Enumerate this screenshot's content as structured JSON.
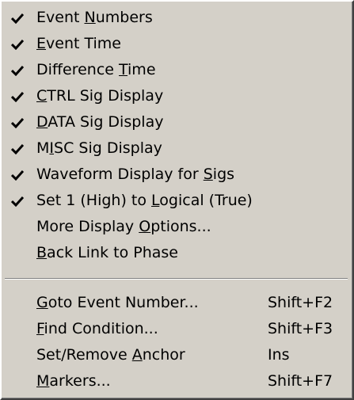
{
  "menu": {
    "items": [
      {
        "checked": true,
        "pre": "Event ",
        "ul": "N",
        "post": "umbers",
        "shortcut": ""
      },
      {
        "checked": true,
        "pre": "",
        "ul": "E",
        "post": "vent Time",
        "shortcut": ""
      },
      {
        "checked": true,
        "pre": "Difference ",
        "ul": "T",
        "post": "ime",
        "shortcut": ""
      },
      {
        "checked": true,
        "pre": "",
        "ul": "C",
        "post": "TRL Sig Display",
        "shortcut": ""
      },
      {
        "checked": true,
        "pre": "",
        "ul": "D",
        "post": "ATA Sig Display",
        "shortcut": ""
      },
      {
        "checked": true,
        "pre": "M",
        "ul": "I",
        "post": "SC Sig Display",
        "shortcut": ""
      },
      {
        "checked": true,
        "pre": "Waveform Display for ",
        "ul": "S",
        "post": "igs",
        "shortcut": ""
      },
      {
        "checked": true,
        "pre": "Set 1 (High) to ",
        "ul": "L",
        "post": "ogical (True)",
        "shortcut": ""
      },
      {
        "checked": false,
        "pre": "More Display ",
        "ul": "O",
        "post": "ptions...",
        "shortcut": ""
      },
      {
        "checked": false,
        "pre": "",
        "ul": "B",
        "post": "ack Link to Phase",
        "shortcut": ""
      },
      {
        "checked": false,
        "pre": "",
        "ul": "G",
        "post": "oto Event Number...",
        "shortcut": "Shift+F2"
      },
      {
        "checked": false,
        "pre": "",
        "ul": "F",
        "post": "ind Condition...",
        "shortcut": "Shift+F3"
      },
      {
        "checked": false,
        "pre": "Set/Remove ",
        "ul": "A",
        "post": "nchor",
        "shortcut": "Ins"
      },
      {
        "checked": false,
        "pre": "",
        "ul": "M",
        "post": "arkers...",
        "shortcut": "Shift+F7"
      }
    ]
  },
  "icons": {
    "check": "checkmark-icon"
  },
  "colors": {
    "menu_background": "#d4d0c8",
    "text": "#000000"
  }
}
